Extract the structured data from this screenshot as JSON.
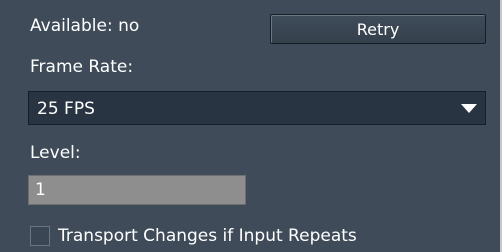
{
  "availability": {
    "text": "Available: no"
  },
  "retry_button": {
    "label": "Retry"
  },
  "frame_rate": {
    "label": "Frame Rate:",
    "selected": "25 FPS",
    "dropdown_icon": "triangle-down"
  },
  "level": {
    "label": "Level:",
    "value": "1"
  },
  "transport_changes": {
    "label": "Transport Changes if Input Repeats",
    "checked": false
  },
  "colors": {
    "panel_background": "#3f4b58",
    "dropdown_background": "#283442",
    "input_background": "#8e8e8e",
    "text": "#ffffff"
  }
}
